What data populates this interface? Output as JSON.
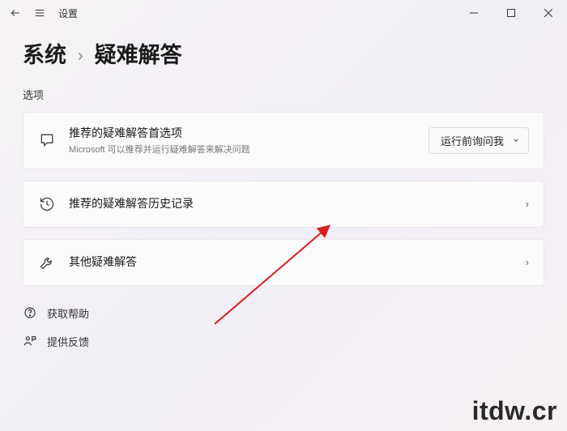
{
  "titlebar": {
    "app_name": "设置"
  },
  "breadcrumb": {
    "parent": "系统",
    "current": "疑难解答"
  },
  "section_label": "选项",
  "cards": {
    "recommended": {
      "title": "推荐的疑难解答首选项",
      "subtitle": "Microsoft 可以推荐并运行疑难解答来解决问题"
    },
    "history": {
      "title": "推荐的疑难解答历史记录"
    },
    "other": {
      "title": "其他疑难解答"
    }
  },
  "dropdown": {
    "selected": "运行前询问我"
  },
  "links": {
    "help": "获取帮助",
    "feedback": "提供反馈"
  },
  "watermark": "itdw.cr"
}
